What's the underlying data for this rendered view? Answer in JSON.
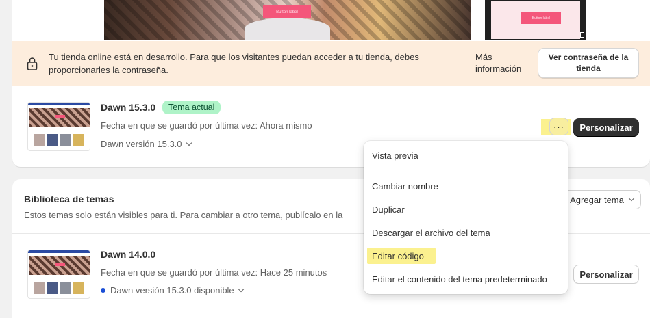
{
  "preview": {
    "desktop_button_label": "Button label",
    "mobile_button_label": "Button label"
  },
  "banner": {
    "icon": "lock-icon",
    "message": "Tu tienda online está en desarrollo. Para que los visitantes puedan acceder a tu tienda, debes proporcionarles la contraseña.",
    "more_info_label": "Más información",
    "password_button_label": "Ver contraseña de la tienda"
  },
  "current_theme": {
    "name": "Dawn 15.3.0",
    "badge": "Tema actual",
    "saved_text": "Fecha en que se guardó por última vez: Ahora mismo",
    "version_text": "Dawn versión 15.3.0",
    "more_actions_label": "···",
    "customize_label": "Personalizar"
  },
  "library": {
    "title": "Biblioteca de temas",
    "subtitle": "Estos temas solo están visibles para ti. Para cambiar a otro tema, publícalo en la",
    "add_theme_label": "Agregar tema",
    "themes": [
      {
        "name": "Dawn 14.0.0",
        "saved_text": "Fecha en que se guardó por última vez: Hace 25 minutos",
        "version_text": "Dawn versión 15.3.0 disponible",
        "customize_label": "Personalizar"
      }
    ]
  },
  "menu": {
    "items": [
      "Vista previa",
      "Cambiar nombre",
      "Duplicar",
      "Descargar el archivo del tema",
      "Editar código",
      "Editar el contenido del tema predeterminado"
    ],
    "highlighted_item": "Editar código"
  },
  "colors": {
    "banner_bg": "#fdeddd",
    "badge_bg": "#aff3c8",
    "highlight": "#fbf18f",
    "primary_button": "#303030",
    "update_dot": "#1b4fd6"
  }
}
